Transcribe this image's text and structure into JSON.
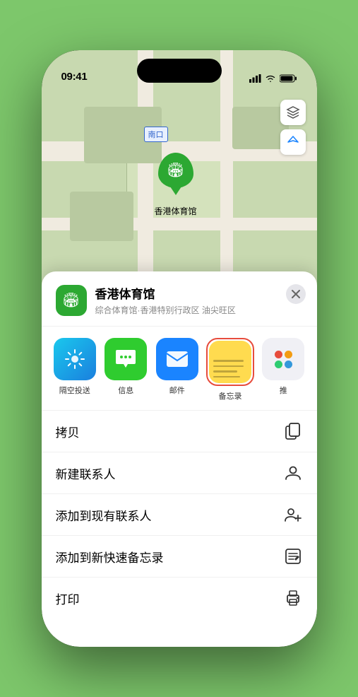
{
  "status_bar": {
    "time": "09:41",
    "location_arrow": "▶"
  },
  "map": {
    "label_nankou": "南口",
    "stadium_label": "香港体育馆"
  },
  "location_card": {
    "name": "香港体育馆",
    "subtitle": "综合体育馆·香港特别行政区 油尖旺区",
    "close_label": "×"
  },
  "share_items": [
    {
      "id": "airdrop",
      "label": "隔空投送",
      "type": "airdrop"
    },
    {
      "id": "message",
      "label": "信息",
      "type": "message"
    },
    {
      "id": "mail",
      "label": "邮件",
      "type": "mail"
    },
    {
      "id": "notes",
      "label": "备忘录",
      "type": "notes"
    },
    {
      "id": "more",
      "label": "推",
      "type": "more"
    }
  ],
  "action_items": [
    {
      "label": "拷贝",
      "icon": "copy"
    },
    {
      "label": "新建联系人",
      "icon": "person"
    },
    {
      "label": "添加到现有联系人",
      "icon": "person-add"
    },
    {
      "label": "添加到新快速备忘录",
      "icon": "memo"
    },
    {
      "label": "打印",
      "icon": "print"
    }
  ]
}
